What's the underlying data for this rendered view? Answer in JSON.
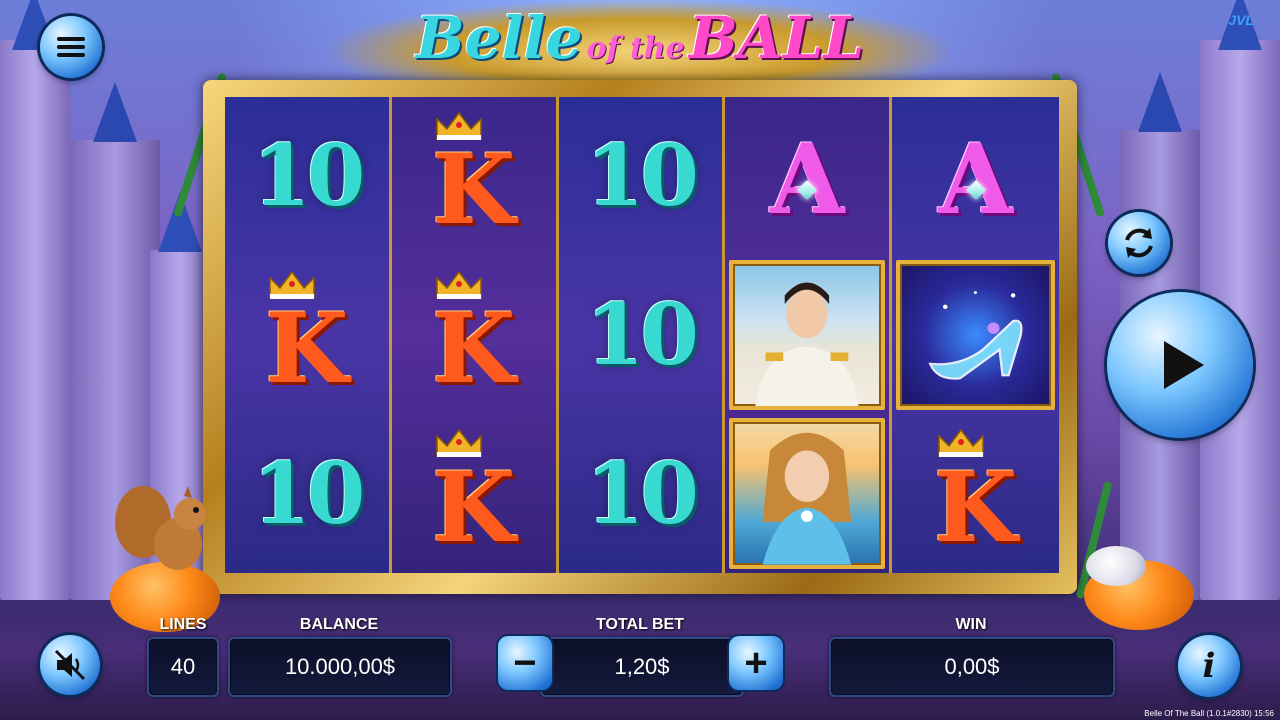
{
  "game": {
    "title_part1": "Belle",
    "title_part2": "of the",
    "title_part3": "BALL",
    "brand": "JVL"
  },
  "reels": [
    [
      "10",
      "K",
      "10"
    ],
    [
      "K",
      "K",
      "K"
    ],
    [
      "10",
      "10",
      "10"
    ],
    [
      "A",
      "prince",
      "belle"
    ],
    [
      "A",
      "glass-slipper",
      "K"
    ]
  ],
  "panel": {
    "lines_label": "LINES",
    "lines_value": "40",
    "balance_label": "BALANCE",
    "balance_value": "10.000,00$",
    "total_bet_label": "TOTAL BET",
    "total_bet_value": "1,20$",
    "minus_label": "−",
    "plus_label": "+",
    "win_label": "WIN",
    "win_value": "0,00$",
    "info_label": "i"
  },
  "footer": "Belle Of The Ball (1.0.1#2830) 15:56",
  "icons": {
    "menu": "hamburger-icon",
    "refresh": "refresh-icon",
    "spin": "play-icon",
    "mute": "speaker-muted-icon",
    "info": "info-icon"
  },
  "colors": {
    "ten": "#38d9d0",
    "king": "#ff5a1e",
    "ace": "#f05ae8",
    "frame_gold": "#d9a844",
    "button_blue": "#1f6fd2"
  }
}
